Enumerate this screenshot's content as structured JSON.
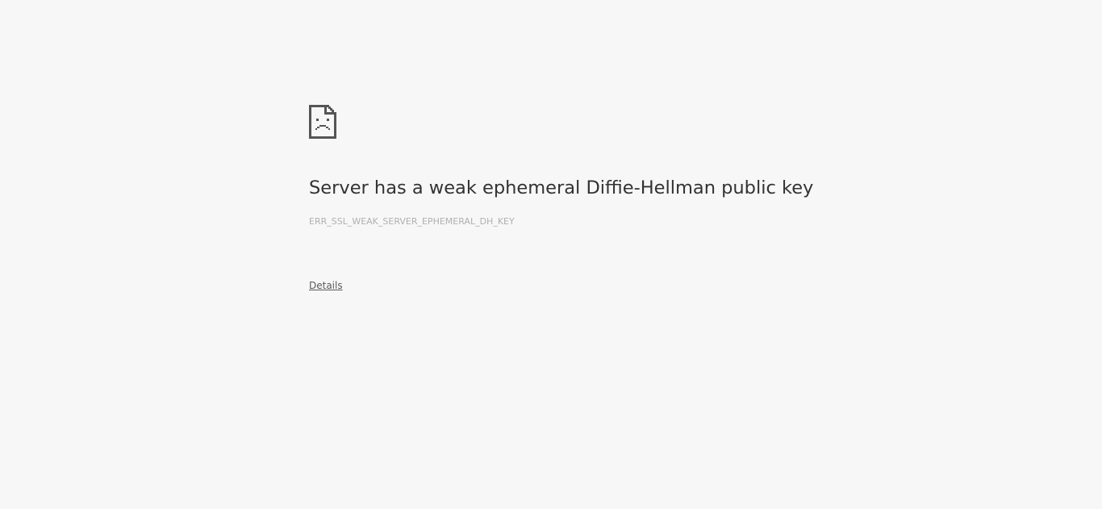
{
  "error": {
    "icon": "sad-document-icon",
    "title": "Server has a weak ephemeral Diffie-Hellman public key",
    "code": "ERR_SSL_WEAK_SERVER_EPHEMERAL_DH_KEY",
    "details_label": "Details"
  },
  "colors": {
    "background": "#f7f7f7",
    "title": "#333333",
    "code": "#b0b0b0",
    "link": "#5a5a5a",
    "icon": "#555555"
  }
}
